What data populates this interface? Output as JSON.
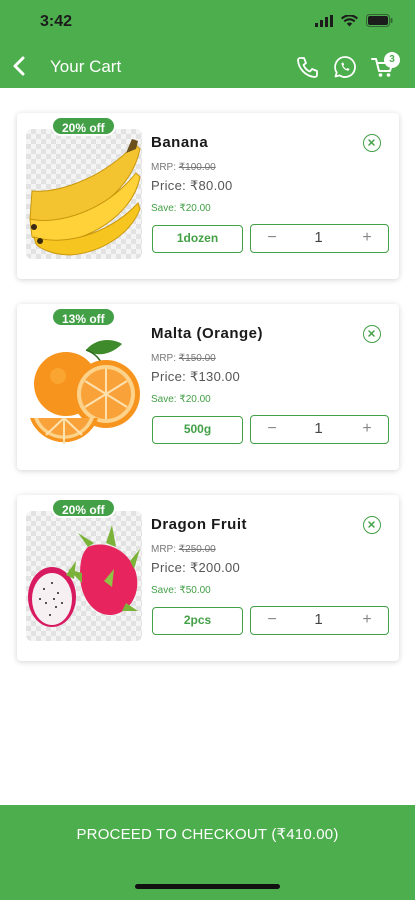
{
  "status": {
    "time": "3:42"
  },
  "header": {
    "title": "Your Cart",
    "cart_count": "3"
  },
  "items": [
    {
      "discount": "20% off",
      "name": "Banana",
      "mrp_label": "MRP:",
      "mrp": "₹100.00",
      "price_label": "Price:",
      "price": "₹80.00",
      "save": "Save: ₹20.00",
      "unit": "1dozen",
      "qty": "1",
      "minus": "−",
      "plus": "+"
    },
    {
      "discount": "13% off",
      "name": "Malta (Orange)",
      "mrp_label": "MRP:",
      "mrp": "₹150.00",
      "price_label": "Price:",
      "price": "₹130.00",
      "save": "Save: ₹20.00",
      "unit": "500g",
      "qty": "1",
      "minus": "−",
      "plus": "+"
    },
    {
      "discount": "20% off",
      "name": "Dragon Fruit",
      "mrp_label": "MRP:",
      "mrp": "₹250.00",
      "price_label": "Price:",
      "price": "₹200.00",
      "save": "Save: ₹50.00",
      "unit": "2pcs",
      "qty": "1",
      "minus": "−",
      "plus": "+"
    }
  ],
  "checkout": {
    "label": "PROCEED TO CHECKOUT (₹410.00)"
  },
  "colors": {
    "brand_green": "#4cae4c",
    "accent_green": "#43a047"
  },
  "icons": [
    "back-arrow-icon",
    "phone-icon",
    "whatsapp-icon",
    "cart-icon",
    "remove-icon"
  ]
}
